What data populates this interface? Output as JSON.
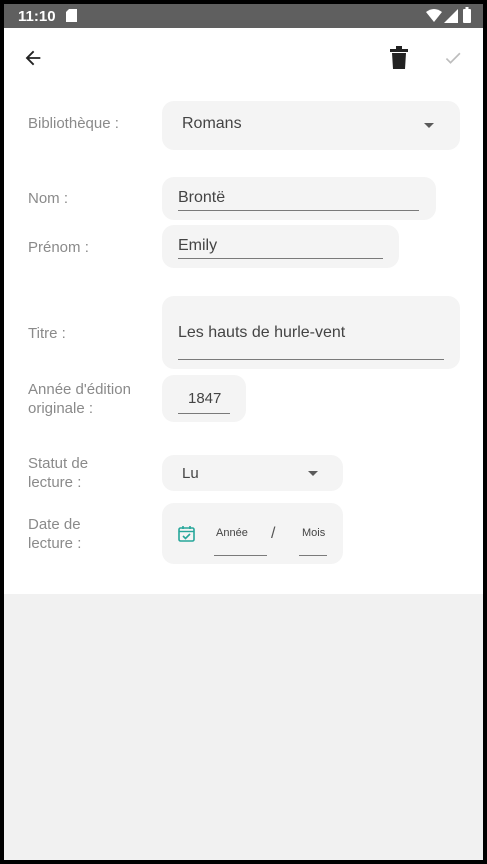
{
  "status_bar": {
    "time": "11:10",
    "icons": [
      "sd-card-icon",
      "wifi-icon",
      "signal-icon",
      "battery-icon"
    ]
  },
  "toolbar": {
    "back_icon": "arrow-left-icon",
    "delete_icon": "trash-icon",
    "confirm_icon": "check-icon"
  },
  "form": {
    "library": {
      "label": "Bibliothèque :",
      "value": "Romans"
    },
    "last_name": {
      "label": "Nom :",
      "value": "Brontë"
    },
    "first_name": {
      "label": "Prénom :",
      "value": "Emily"
    },
    "title": {
      "label": "Titre :",
      "value": "Les hauts de hurle-vent"
    },
    "original_year": {
      "label_line1": "Année d'édition",
      "label_line2": "originale :",
      "value": "1847"
    },
    "reading_status": {
      "label_line1": "Statut de",
      "label_line2": "lecture :",
      "value": "Lu"
    },
    "reading_date": {
      "label_line1": "Date de",
      "label_line2": "lecture :",
      "year_placeholder": "Année",
      "separator": "/",
      "month_placeholder": "Mois",
      "icon": "calendar-check-icon"
    }
  },
  "colors": {
    "status_bar": "#5f5f5f",
    "field_background": "#f4f4f4",
    "label": "#8a8a8a",
    "calendar_icon": "#26a69a"
  }
}
